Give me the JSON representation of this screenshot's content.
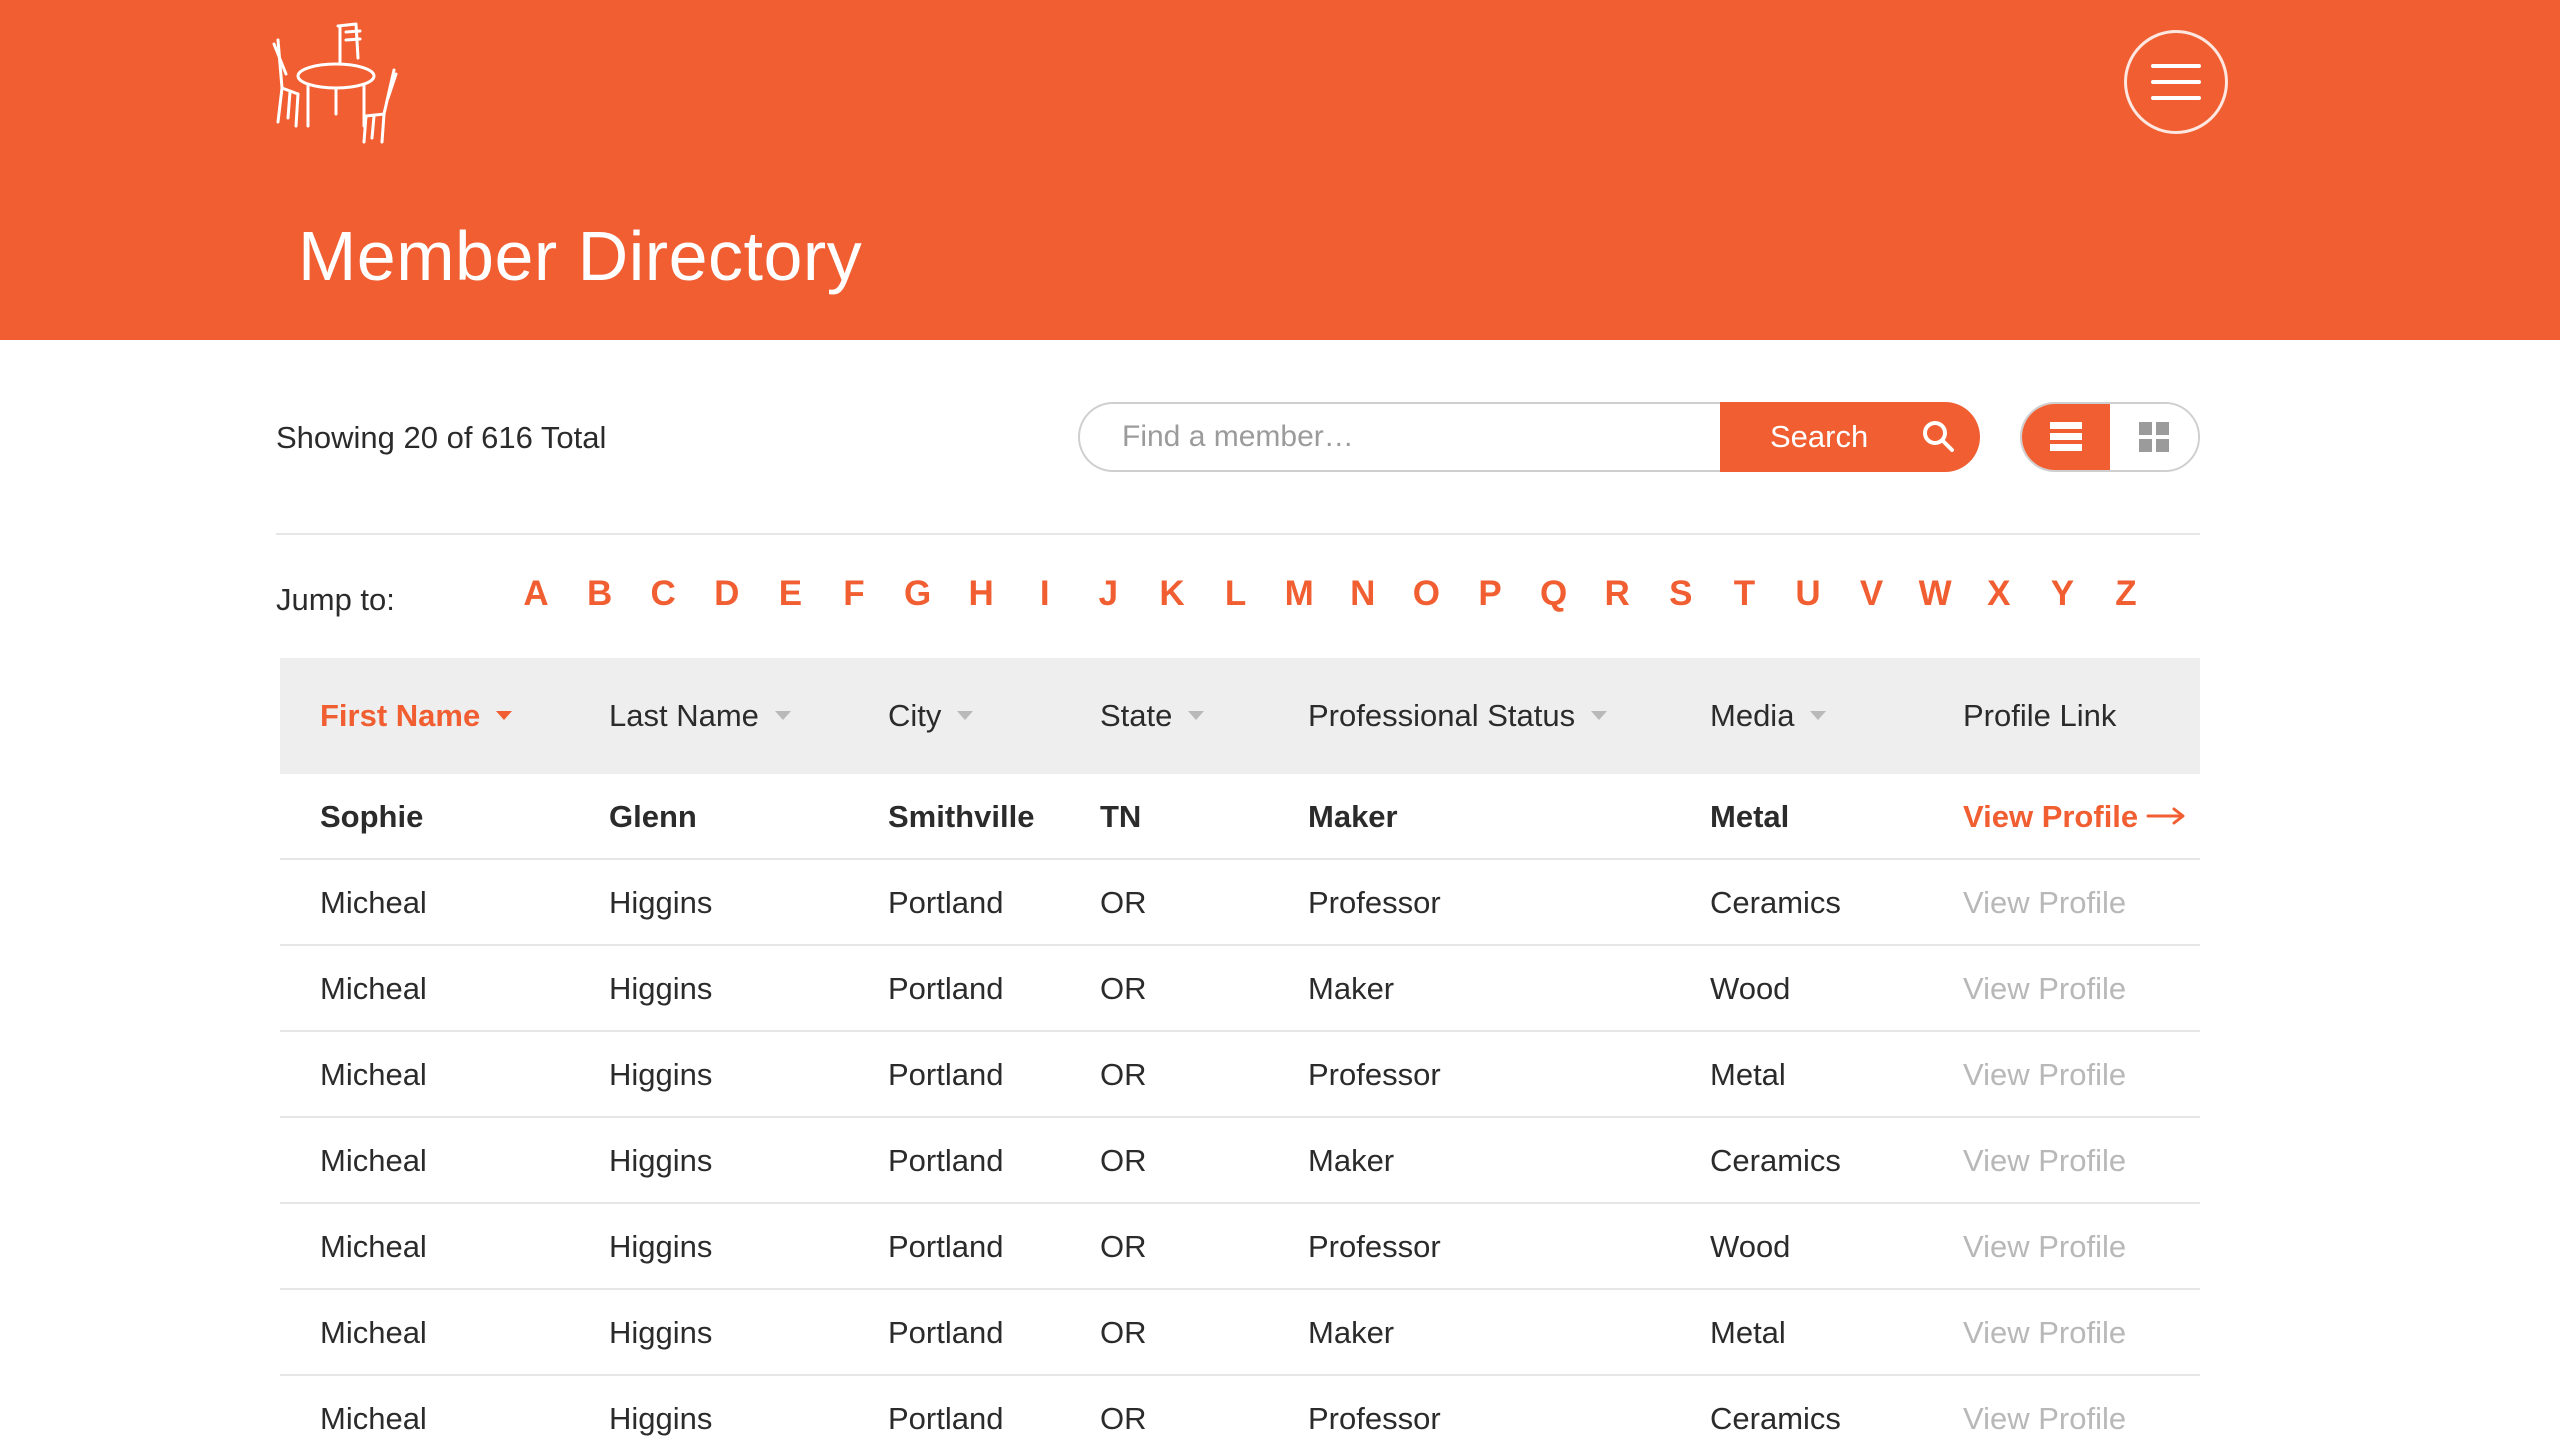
{
  "header": {
    "title": "Member Directory",
    "logo_icon": "table-and-chairs-icon",
    "menu_icon": "hamburger-menu-icon"
  },
  "toolbar": {
    "showing_text": "Showing 20 of 616 Total",
    "search_placeholder": "Find a member…",
    "search_value": "",
    "search_label": "Search",
    "search_icon": "search-icon",
    "view_modes": [
      "list",
      "grid"
    ],
    "active_view": "list"
  },
  "jump": {
    "label": "Jump to:",
    "letters": [
      "A",
      "B",
      "C",
      "D",
      "E",
      "F",
      "G",
      "H",
      "I",
      "J",
      "K",
      "L",
      "M",
      "N",
      "O",
      "P",
      "Q",
      "R",
      "S",
      "T",
      "U",
      "V",
      "W",
      "X",
      "Y",
      "Z"
    ]
  },
  "table": {
    "columns": [
      {
        "label": "First Name",
        "sortable": true,
        "active": true
      },
      {
        "label": "Last Name",
        "sortable": true,
        "active": false
      },
      {
        "label": "City",
        "sortable": true,
        "active": false
      },
      {
        "label": "State",
        "sortable": true,
        "active": false
      },
      {
        "label": "Professional Status",
        "sortable": true,
        "active": false
      },
      {
        "label": "Media",
        "sortable": true,
        "active": false
      },
      {
        "label": "Profile Link",
        "sortable": false,
        "active": false
      }
    ],
    "rows": [
      {
        "first": "Sophie",
        "last": "Glenn",
        "city": "Smithville",
        "state": "TN",
        "status": "Maker",
        "media": "Metal",
        "link": "View Profile",
        "highlight": true
      },
      {
        "first": "Micheal",
        "last": "Higgins",
        "city": "Portland",
        "state": "OR",
        "status": "Professor",
        "media": "Ceramics",
        "link": "View Profile",
        "highlight": false
      },
      {
        "first": "Micheal",
        "last": "Higgins",
        "city": "Portland",
        "state": "OR",
        "status": "Maker",
        "media": "Wood",
        "link": "View Profile",
        "highlight": false
      },
      {
        "first": "Micheal",
        "last": "Higgins",
        "city": "Portland",
        "state": "OR",
        "status": "Professor",
        "media": "Metal",
        "link": "View Profile",
        "highlight": false
      },
      {
        "first": "Micheal",
        "last": "Higgins",
        "city": "Portland",
        "state": "OR",
        "status": "Maker",
        "media": "Ceramics",
        "link": "View Profile",
        "highlight": false
      },
      {
        "first": "Micheal",
        "last": "Higgins",
        "city": "Portland",
        "state": "OR",
        "status": "Professor",
        "media": "Wood",
        "link": "View Profile",
        "highlight": false
      },
      {
        "first": "Micheal",
        "last": "Higgins",
        "city": "Portland",
        "state": "OR",
        "status": "Maker",
        "media": "Metal",
        "link": "View Profile",
        "highlight": false
      },
      {
        "first": "Micheal",
        "last": "Higgins",
        "city": "Portland",
        "state": "OR",
        "status": "Professor",
        "media": "Ceramics",
        "link": "View Profile",
        "highlight": false
      }
    ]
  },
  "colors": {
    "accent": "#f05e31",
    "header_bg": "#f05e31",
    "table_header_bg": "#eeeeee",
    "muted_link": "#b8b8b8",
    "divider": "#e6e6e6"
  }
}
